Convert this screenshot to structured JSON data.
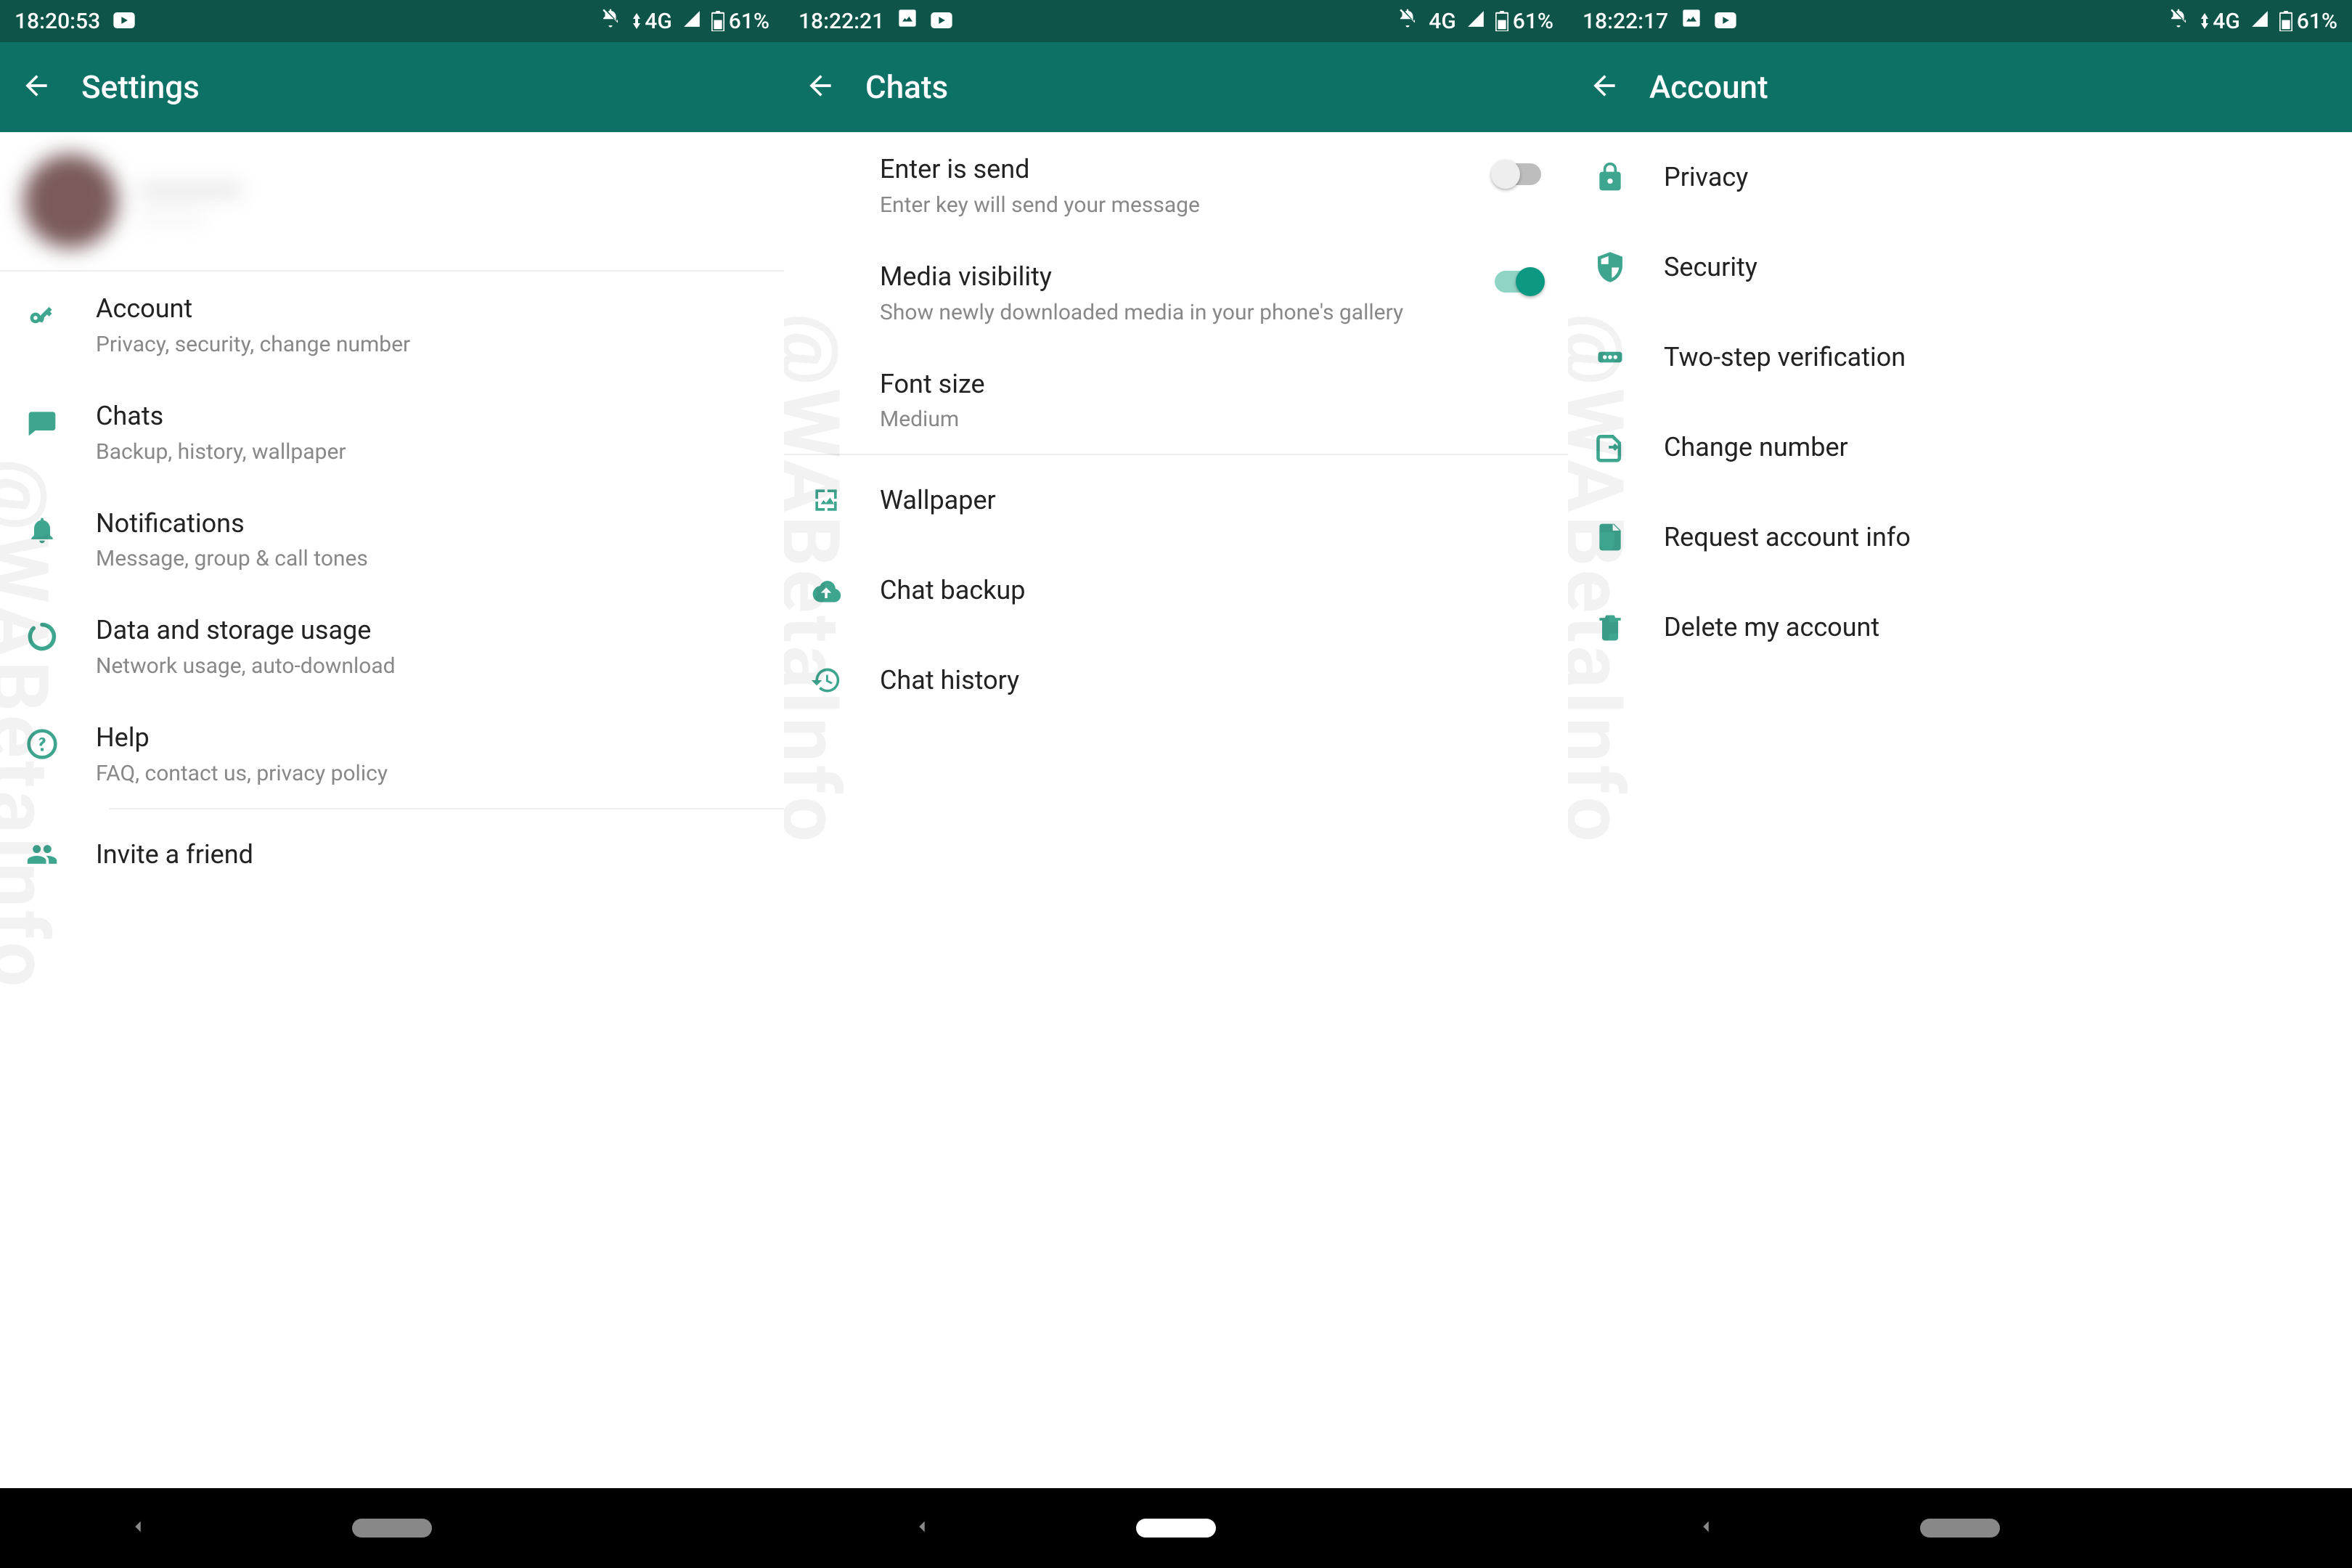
{
  "screens": [
    {
      "status": {
        "time": "18:20:53",
        "network": "4G",
        "battery": "61%"
      },
      "title": "Settings",
      "profile": {
        "name": "————",
        "sub": "————"
      },
      "items": [
        {
          "title": "Account",
          "subtitle": "Privacy, security, change number"
        },
        {
          "title": "Chats",
          "subtitle": "Backup, history, wallpaper"
        },
        {
          "title": "Notifications",
          "subtitle": "Message, group & call tones"
        },
        {
          "title": "Data and storage usage",
          "subtitle": "Network usage, auto-download"
        },
        {
          "title": "Help",
          "subtitle": "FAQ, contact us, privacy policy"
        },
        {
          "title": "Invite a friend"
        }
      ]
    },
    {
      "status": {
        "time": "18:22:21",
        "network": "4G",
        "battery": "61%"
      },
      "title": "Chats",
      "toggles": [
        {
          "title": "Enter is send",
          "subtitle": "Enter key will send your message",
          "on": false
        },
        {
          "title": "Media visibility",
          "subtitle": "Show newly downloaded media in your phone's gallery",
          "on": true
        }
      ],
      "font": {
        "title": "Font size",
        "value": "Medium"
      },
      "items": [
        {
          "title": "Wallpaper"
        },
        {
          "title": "Chat backup"
        },
        {
          "title": "Chat history"
        }
      ]
    },
    {
      "status": {
        "time": "18:22:17",
        "network": "4G",
        "battery": "61%"
      },
      "title": "Account",
      "items": [
        {
          "title": "Privacy"
        },
        {
          "title": "Security"
        },
        {
          "title": "Two-step verification"
        },
        {
          "title": "Change number"
        },
        {
          "title": "Request account info"
        },
        {
          "title": "Delete my account"
        }
      ]
    }
  ],
  "watermark": "@WABetaInfo"
}
